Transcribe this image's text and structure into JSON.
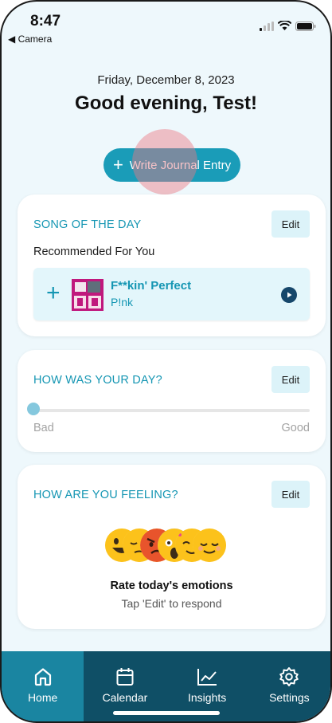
{
  "status_bar": {
    "time": "8:47",
    "back_label": "◀ Camera"
  },
  "header": {
    "date": "Friday, December 8, 2023",
    "greeting": "Good evening, Test!"
  },
  "write_entry_button": {
    "label": "Write Journal Entry"
  },
  "song_card": {
    "title": "SONG OF THE DAY",
    "edit_label": "Edit",
    "subtitle": "Recommended For You",
    "song": {
      "title": "F**kin' Perfect",
      "artist": "P!nk"
    }
  },
  "day_card": {
    "title": "HOW WAS YOUR DAY?",
    "edit_label": "Edit",
    "rating": 0,
    "label_low": "Bad",
    "label_high": "Good"
  },
  "feeling_card": {
    "title": "HOW ARE YOU FEELING?",
    "edit_label": "Edit",
    "emojis": [
      "grinning",
      "pensive",
      "angry",
      "screaming",
      "partying",
      "relieved"
    ],
    "prompt_title": "Rate today's emotions",
    "prompt_sub": "Tap 'Edit' to respond"
  },
  "tabs": [
    {
      "label": "Home",
      "icon": "home-icon",
      "active": true
    },
    {
      "label": "Calendar",
      "icon": "calendar-icon",
      "active": false
    },
    {
      "label": "Insights",
      "icon": "chart-icon",
      "active": false
    },
    {
      "label": "Settings",
      "icon": "gear-icon",
      "active": false
    }
  ],
  "colors": {
    "accent": "#1a9cb8",
    "tabbar": "#0f4f66",
    "tab_active": "#1a85a1",
    "background": "#eef8fc"
  }
}
